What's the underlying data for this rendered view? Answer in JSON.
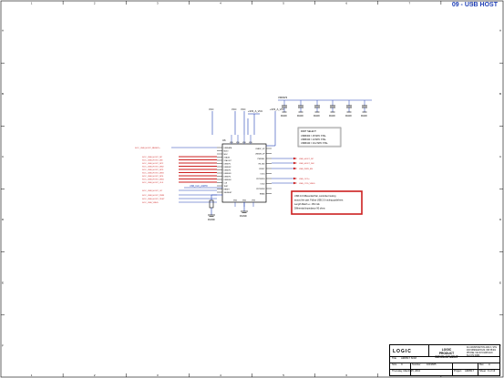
{
  "sheet": {
    "title": "09 - USB HOST"
  },
  "border": {
    "cols": [
      "1",
      "2",
      "3",
      "4",
      "5",
      "6",
      "7",
      "8"
    ],
    "rows": [
      "A",
      "B",
      "C",
      "D",
      "E",
      "F"
    ]
  },
  "power_rails": {
    "vcc_left": "VCC",
    "vcc_mid1": "VCC",
    "vcc_mid2": "VCC",
    "rail_3v3": "+3V3_A_VCC",
    "ldo": "+3V3_A_VCC",
    "cap_rail": "VDD3V3"
  },
  "chip": {
    "ref": "U6",
    "top_pins": [
      "VDD",
      "VDD",
      "VDD",
      "VDD"
    ],
    "left_pins": [
      "USBDATA",
      "MDIO",
      "MDC",
      "XTALIN",
      "XTALOUT",
      "USBDP2",
      "USBDM2",
      "USBDP3",
      "USBDM3",
      "USBDP4",
      "USBDM4",
      "CLK",
      "TEST",
      "RESET",
      "VBUSDET"
    ],
    "right_pins": [
      "USBDP_UP",
      "USBDM_UP",
      "PWRSEL",
      "HS_IND",
      "CRFILT",
      "OCS1",
      "PRTPWR1",
      "OCS2",
      "PRTPWR2",
      "RBIAS"
    ],
    "bottom_pins": [
      "GND",
      "GND",
      "VSS"
    ]
  },
  "nets_left": [
    "SOC_USB_HOST_RESETn",
    "SOC_USB_HOST_DP",
    "SOC_USB_HOST_DM",
    "SOC_USB_HOST_DP2",
    "SOC_USB_HOST_DM2",
    "SOC_USB_HOST_DP3",
    "SOC_USB_HOST_DM3",
    "SOC_USB_HOST_DP4",
    "SOC_USB_HOST_DM4",
    "SOC_USB_HOST_CLK",
    "SOC_USB_HOST_OC",
    "SOC_USB_HOST_PWR",
    "SOC_USB_HOST_TEST",
    "SOC_USB_VBUS"
  ],
  "nets_right": [
    "USB_HOST_DP",
    "USB_HOST_DM",
    "USB_PWR_EN",
    "USB_OC1n",
    "USB_OTG_VBUS"
  ],
  "net_inline": "USB_CLK_24MHz",
  "part_note": {
    "title": "PART SELECT:",
    "lines": [
      "USB3300 = 25 MHz XTAL",
      "USB3320 = 24 MHz XTAL",
      "USB3340 = 19.2 MHz XTAL"
    ]
  },
  "usb_note": {
    "lines": [
      "USB 2.0 Differential Pair, controlled routing",
      "around the pair. Follow USB 2.0 routing guidelines:",
      "Length Match +/- 150 mils",
      "Differential impedance 90 ohms"
    ]
  },
  "gnd_labels": [
    "DGND",
    "DGND",
    "DGND",
    "DGND",
    "DGND",
    "DGND",
    "DGND"
  ],
  "title_block": {
    "logo": "LOGIC",
    "company_line1": "LOGIC",
    "company_line2": "PRODUCT DEVELOPMENT",
    "address": "411 WASHINGTON AVE N, STE 400 MINNEAPOLIS, MN 55401 PHONE: 612.672.9495 FAX: 612.672.9489",
    "title_label": "Title",
    "title_value": "AM3517 SOM",
    "size_label": "Size",
    "size_value": "C",
    "number_label": "Number",
    "number_value": "1019665",
    "rev_label": "Rev",
    "rev_value": "A",
    "date_label": "Thursday, March 25, 2010",
    "project_label": "Project",
    "project_value": "AM3517",
    "sheet_label": "Sheet",
    "sheet_value": "9 of 13"
  },
  "colors": {
    "wire": "#1f3fb5",
    "net": "#cc1f1f",
    "line": "#000000",
    "note_border": "#cc1f1f",
    "part_note_border": "#888888"
  }
}
